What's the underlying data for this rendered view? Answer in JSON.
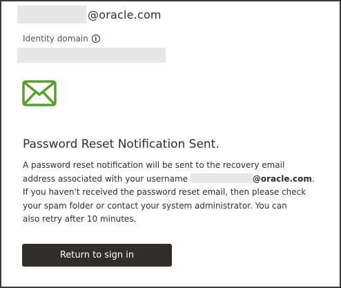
{
  "account": {
    "username_suffix": "@oracle.com"
  },
  "identity_domain": {
    "label": "Identity domain",
    "info_icon": "info-circle-icon",
    "info_glyph": "i"
  },
  "notice": {
    "icon": "envelope-icon",
    "icon_color": "#5a9e2f",
    "title": "Password Reset Notification Sent.",
    "line1": "A password reset notification will be sent to the recovery email",
    "line2_prefix": "address associated with your username",
    "line2_email_suffix": "@oracle.com",
    "line2_end": ".",
    "line3": "If you haven't received the password reset email, then please check",
    "line4": "your spam folder or contact your system administrator. You can",
    "line5": "also retry after 10 minutes."
  },
  "actions": {
    "return_label": "Return to sign in",
    "button_color": "#312d2a"
  }
}
